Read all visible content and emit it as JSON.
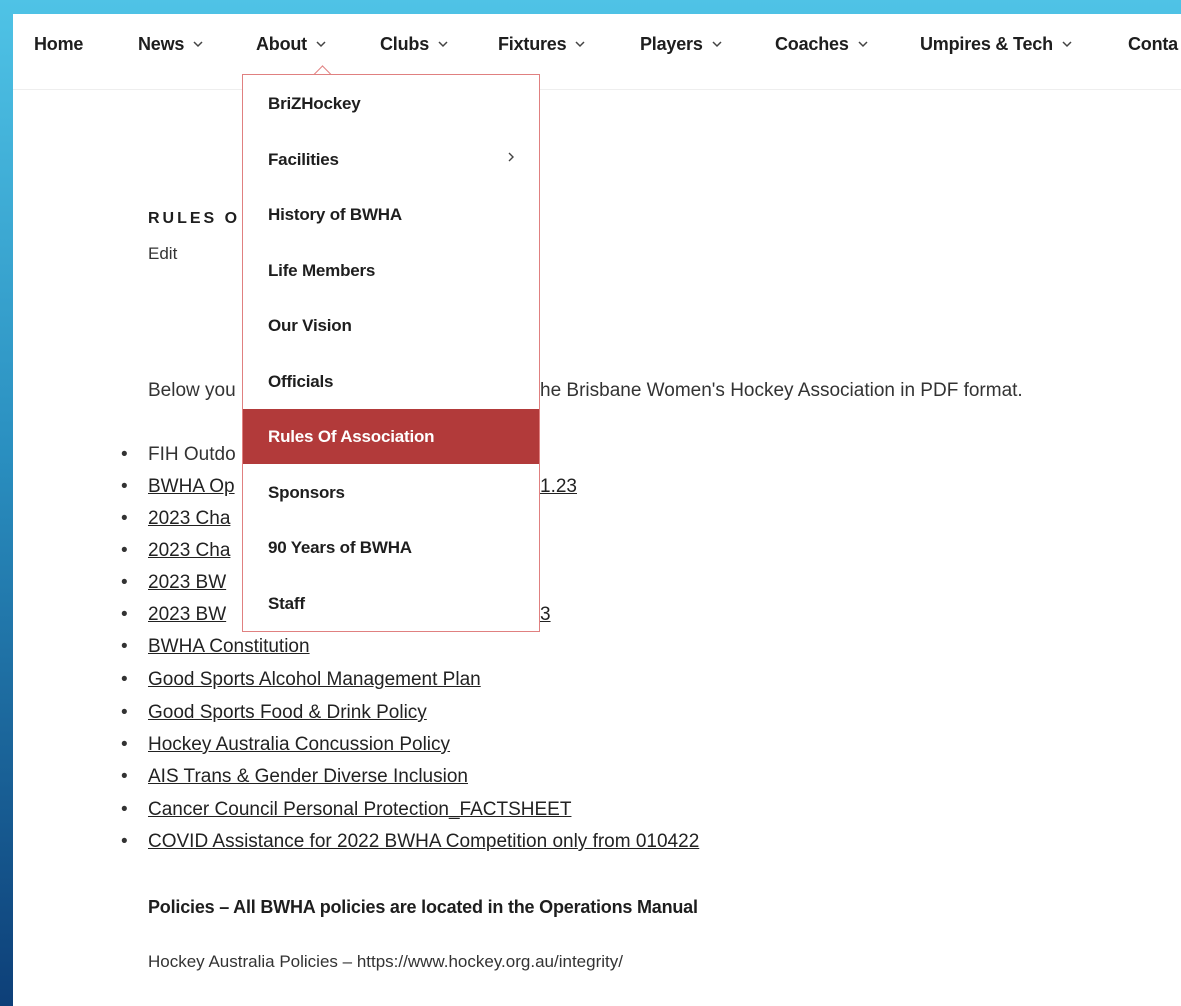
{
  "nav": {
    "items": [
      {
        "label": "Home",
        "has_dropdown": false
      },
      {
        "label": "News",
        "has_dropdown": true
      },
      {
        "label": "About",
        "has_dropdown": true
      },
      {
        "label": "Clubs",
        "has_dropdown": true
      },
      {
        "label": "Fixtures",
        "has_dropdown": true
      },
      {
        "label": "Players",
        "has_dropdown": true
      },
      {
        "label": "Coaches",
        "has_dropdown": true
      },
      {
        "label": "Umpires & Tech",
        "has_dropdown": true
      },
      {
        "label": "Conta"
      }
    ]
  },
  "about_menu": {
    "items": [
      {
        "label": "BriZHockey"
      },
      {
        "label": "Facilities",
        "submenu_icon": "chevron-right-icon"
      },
      {
        "label": "History of BWHA"
      },
      {
        "label": "Life Members"
      },
      {
        "label": "Our Vision"
      },
      {
        "label": "Officials"
      },
      {
        "label": "Rules Of Association",
        "active": true
      },
      {
        "label": "Sponsors"
      },
      {
        "label": "90 Years of BWHA"
      },
      {
        "label": "Staff"
      }
    ]
  },
  "content": {
    "title_visible": "RULES O",
    "edit_link": "Edit",
    "intro_left": "Below you",
    "intro_right": "he Brisbane Women's Hockey Association in PDF format.",
    "list_fragments": {
      "item1_left": "FIH Outdo",
      "item2_left": "BWHA Op",
      "item2_right": "1.23",
      "item3_left": "2023 Cha",
      "item4_left": "2023 Cha",
      "item5_left": "2023 BW",
      "item6_left": "2023 BW",
      "item6_right": "3"
    },
    "list_items": [
      "BWHA Constitution",
      "Good Sports Alcohol Management Plan",
      "Good Sports Food & Drink Policy",
      "Hockey Australia Concussion Policy",
      "AIS Trans & Gender Diverse Inclusion",
      "Cancer Council Personal Protection_FACTSHEET",
      "COVID Assistance for 2022 BWHA Competition only from 010422"
    ],
    "policies_heading": "Policies – All BWHA policies are located in the Operations Manual",
    "hockey_australia": "Hockey Australia Policies – https://www.hockey.org.au/integrity/"
  },
  "colors": {
    "accent": "#b23a3a",
    "frame_top": "#4fc3e6",
    "frame_bottom": "#0d3f78"
  }
}
